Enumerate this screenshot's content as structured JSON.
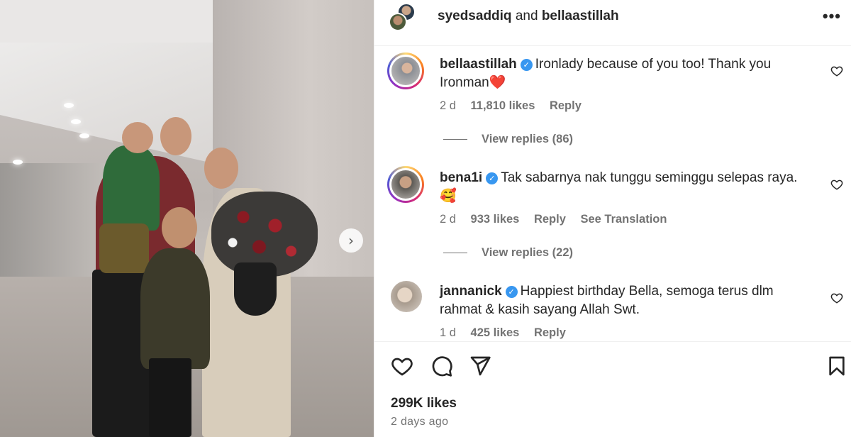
{
  "header": {
    "user1": "syedsaddiq",
    "joiner": " and ",
    "user2": "bellaastillah",
    "more_label": "•••"
  },
  "photo": {
    "next_label": "›"
  },
  "comments": [
    {
      "username": "bellaastillah",
      "verified_mark": "✓",
      "line1": "Ironlady because of you too! Thank you",
      "line2": "Ironman❤️",
      "age": "2 d",
      "likes": "11,810 likes",
      "reply": "Reply",
      "view_replies": "View replies (86)"
    },
    {
      "username": "bena1i",
      "verified_mark": "✓",
      "line1": "Tak sabarnya nak tunggu seminggu selepas raya.",
      "line2": "🥰",
      "age": "2 d",
      "likes": "933 likes",
      "reply": "Reply",
      "translation": "See Translation",
      "view_replies": "View replies (22)"
    },
    {
      "username": "jannanick",
      "verified_mark": "✓",
      "line1": "Happiest birthday Bella, semoga terus dlm",
      "line2": "rahmat & kasih sayang Allah Swt.",
      "age": "1 d",
      "likes": "425 likes",
      "reply": "Reply"
    }
  ],
  "post": {
    "likes": "299K likes",
    "time_ago": "2 days ago"
  },
  "icons": [
    "heart-icon",
    "comment-icon",
    "share-icon",
    "bookmark-icon",
    "more-icon",
    "verified-icon",
    "chevron-right-icon"
  ],
  "colors": {
    "verified": "#3897f0",
    "secondary_text": "#737373",
    "primary_text": "#262626",
    "divider": "#efefef"
  }
}
